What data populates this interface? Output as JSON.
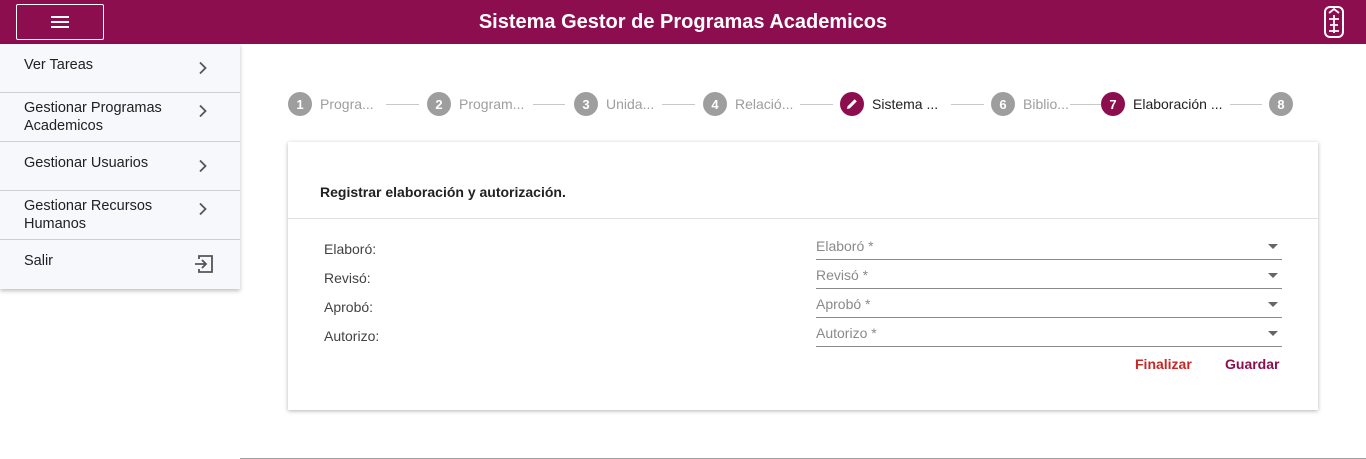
{
  "header": {
    "title": "Sistema Gestor de Programas Academicos",
    "menu_icon": "hamburger-icon",
    "logo": "institution-seal-logo",
    "brand_color": "#8c0e4f"
  },
  "sidebar": {
    "items": [
      {
        "label": "Ver Tareas",
        "icon": "chevron-right-icon"
      },
      {
        "label": "Gestionar Programas Academicos",
        "line1": "Gestionar Programas",
        "line2": "Academicos",
        "icon": "chevron-right-icon"
      },
      {
        "label": "Gestionar Usuarios",
        "icon": "chevron-right-icon"
      },
      {
        "label": "Gestionar Recursos Humanos",
        "line1": "Gestionar Recursos",
        "line2": "Humanos",
        "icon": "chevron-right-icon"
      },
      {
        "label": "Salir",
        "icon": "logout-icon"
      }
    ]
  },
  "stepper": {
    "steps": [
      {
        "number": "1",
        "label": "Progra...",
        "state": "inactive"
      },
      {
        "number": "2",
        "label": "Program...",
        "state": "inactive"
      },
      {
        "number": "3",
        "label": "Unida...",
        "state": "inactive"
      },
      {
        "number": "4",
        "label": "Relació...",
        "state": "inactive"
      },
      {
        "number": "",
        "label": "Sistema ...",
        "state": "edited",
        "icon": "pencil-icon"
      },
      {
        "number": "6",
        "label": "Biblio...",
        "state": "inactive"
      },
      {
        "number": "7",
        "label": "Elaboración ...",
        "state": "active"
      },
      {
        "number": "8",
        "label": "",
        "state": "inactive"
      }
    ]
  },
  "form": {
    "title": "Registrar elaboración y autorización.",
    "fields": [
      {
        "label": "Elaboró:",
        "placeholder": "Elaboró *"
      },
      {
        "label": "Revisó:",
        "placeholder": "Revisó *"
      },
      {
        "label": "Aprobó:",
        "placeholder": "Aprobó *"
      },
      {
        "label": "Autorizo:",
        "placeholder": "Autorizo *"
      }
    ],
    "finalizar_label": "Finalizar",
    "guardar_label": "Guardar",
    "finalizar_color": "#c62828"
  }
}
